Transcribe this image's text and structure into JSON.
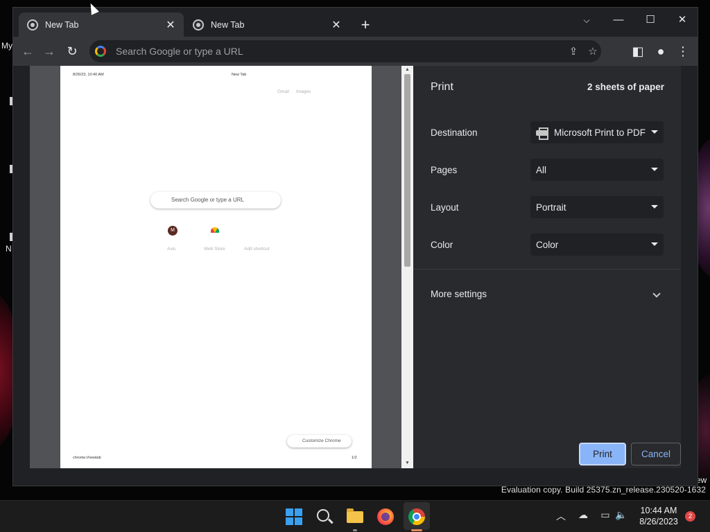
{
  "desktop": {
    "fragments": [
      "My",
      "N",
      "ew"
    ],
    "watermark": "Evaluation copy. Build 25375.zn_release.230520-1632"
  },
  "tabs": [
    {
      "title": "New Tab",
      "active": true,
      "icon": "chrome-icon"
    },
    {
      "title": "New Tab",
      "active": false,
      "icon": "chrome-icon"
    }
  ],
  "window_controls": {
    "tab_search": "tab-search-icon",
    "minimize": "minimize-icon",
    "maximize": "maximize-icon",
    "close": "close-icon"
  },
  "toolbar": {
    "omnibox_placeholder": "Search Google or type a URL",
    "icons": [
      "back-icon",
      "forward-icon",
      "reload-icon",
      "share-icon",
      "bookmark-star-icon",
      "side-panel-icon",
      "profile-icon",
      "menu-icon"
    ]
  },
  "preview_page": {
    "header_left": "8/26/23, 10:40 AM",
    "header_center": "New Tab",
    "top_links": [
      "Gmail",
      "Images"
    ],
    "search_placeholder": "Search Google or type a URL",
    "shortcuts": [
      {
        "label": "Axis",
        "initial": "M",
        "color": "#5a2a20"
      },
      {
        "label": "Web Store",
        "initial": "",
        "color": "#d9534f"
      },
      {
        "label": "Add shortcut",
        "initial": "",
        "color": ""
      }
    ],
    "customize": "Customize Chrome",
    "footer_left": "chrome://newtab",
    "footer_right": "1/2"
  },
  "print": {
    "title": "Print",
    "sheets": "2 sheets of paper",
    "settings": [
      {
        "label": "Destination",
        "value": "Microsoft Print to PDF",
        "icon": "printer-icon"
      },
      {
        "label": "Pages",
        "value": "All"
      },
      {
        "label": "Layout",
        "value": "Portrait"
      },
      {
        "label": "Color",
        "value": "Color"
      }
    ],
    "more_settings": "More settings",
    "print_button": "Print",
    "cancel_button": "Cancel"
  },
  "taskbar": {
    "apps": [
      "start-icon",
      "search-icon",
      "file-explorer-icon",
      "firefox-icon",
      "chrome-icon"
    ],
    "tray_icons": [
      "chevron-up-icon",
      "cloud-offline-icon",
      "display-icon",
      "volume-icon"
    ],
    "time": "10:44 AM",
    "date": "8/26/2023",
    "notifications": "2"
  }
}
